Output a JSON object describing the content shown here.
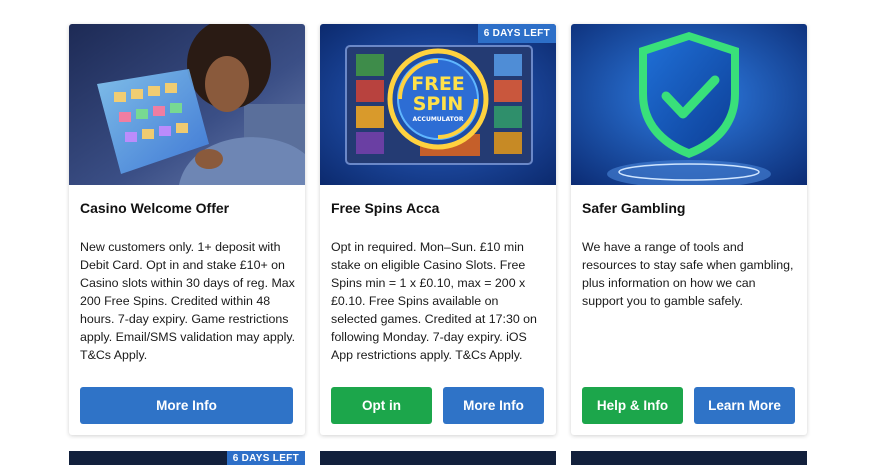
{
  "cards": [
    {
      "title": "Casino Welcome Offer",
      "text": "New customers only. 1+ deposit with Debit Card. Opt in and stake £10+ on Casino slots within 30 days of reg. Max 200 Free Spins. Credited within 48 hours. 7-day expiry. Game restrictions apply. Email/SMS validation may apply. T&Cs Apply.",
      "buttons": [
        {
          "label": "More Info",
          "color": "#2f73c7"
        }
      ]
    },
    {
      "title": "Free Spins Acca",
      "badge": "6 DAYS LEFT",
      "banner_logo": {
        "line1": "FREE",
        "line2": "SPIN",
        "line3": "ACCUMULATOR"
      },
      "text": "Opt in required. Mon–Sun. £10 min stake on eligible Casino Slots. Free Spins min = 1 x £0.10, max = 200 x £0.10. Free Spins available on selected games. Credited at 17:30 on following Monday. 7-day expiry. iOS App restrictions apply. T&Cs Apply.",
      "buttons": [
        {
          "label": "Opt in",
          "color": "#1ca64b"
        },
        {
          "label": "More Info",
          "color": "#2f73c7"
        }
      ]
    },
    {
      "title": "Safer Gambling",
      "text": "We have a range of tools and resources to stay safe when gambling, plus information on how we can support you to gamble safely.",
      "buttons": [
        {
          "label": "Help & Info",
          "color": "#1ca64b"
        },
        {
          "label": "Learn More",
          "color": "#2f73c7"
        }
      ]
    }
  ],
  "next_row": {
    "badge": "6 DAYS LEFT"
  }
}
